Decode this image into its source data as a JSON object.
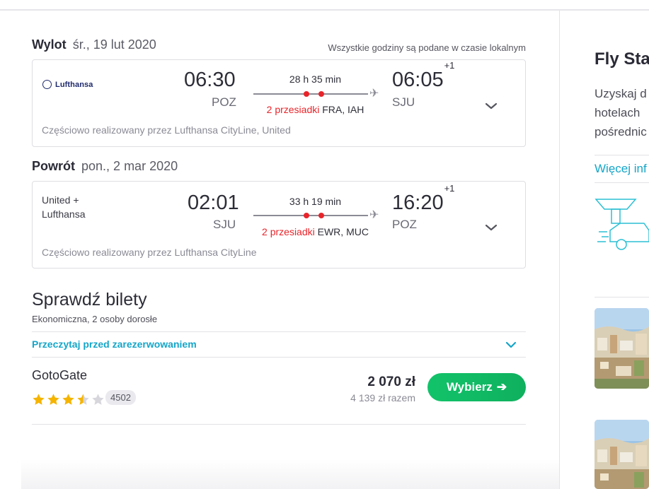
{
  "outbound": {
    "label": "Wylot",
    "date": "śr., 19 lut 2020",
    "tz_note": "Wszystkie godziny są podane w czasie lokalnym",
    "airline": "Lufthansa",
    "depart_time": "06:30",
    "depart_airport": "POZ",
    "duration": "28 h 35 min",
    "stops_label": "2 przesiadki",
    "stops_airports": "FRA, IAH",
    "arrive_time": "06:05",
    "arrive_offset": "+1",
    "arrive_airport": "SJU",
    "operated_by": "Częściowo realizowany przez Lufthansa CityLine, United"
  },
  "return": {
    "label": "Powrót",
    "date": "pon., 2 mar 2020",
    "airline_line1": "United +",
    "airline_line2": "Lufthansa",
    "depart_time": "02:01",
    "depart_airport": "SJU",
    "duration": "33 h 19 min",
    "stops_label": "2 przesiadki",
    "stops_airports": "EWR, MUC",
    "arrive_time": "16:20",
    "arrive_offset": "+1",
    "arrive_airport": "POZ",
    "operated_by": "Częściowo realizowany przez Lufthansa CityLine"
  },
  "tickets": {
    "title": "Sprawdź bilety",
    "subtitle": "Ekonomiczna, 2 osoby dorosłe",
    "read_before": "Przeczytaj przed zarezerwowaniem",
    "vendor": "GotoGate",
    "rating": 3.5,
    "rating_max": 5,
    "reviews": "4502",
    "price": "2 070 zł",
    "price_total": "4 139 zł razem",
    "select_label": "Wybierz"
  },
  "side": {
    "title": "Fly Sta",
    "text_lines": [
      "Uzyskaj d",
      "hotelach ",
      "pośrednic"
    ],
    "link": "Więcej inf"
  },
  "colors": {
    "accent": "#14a6c9",
    "stop_red": "#e8242a",
    "button_green": "#12c36a",
    "star_gold": "#f5b400"
  },
  "icons": {
    "expand": "chevron-down-icon",
    "plane": "plane-icon",
    "select_arrow": "arrow-right-icon"
  }
}
